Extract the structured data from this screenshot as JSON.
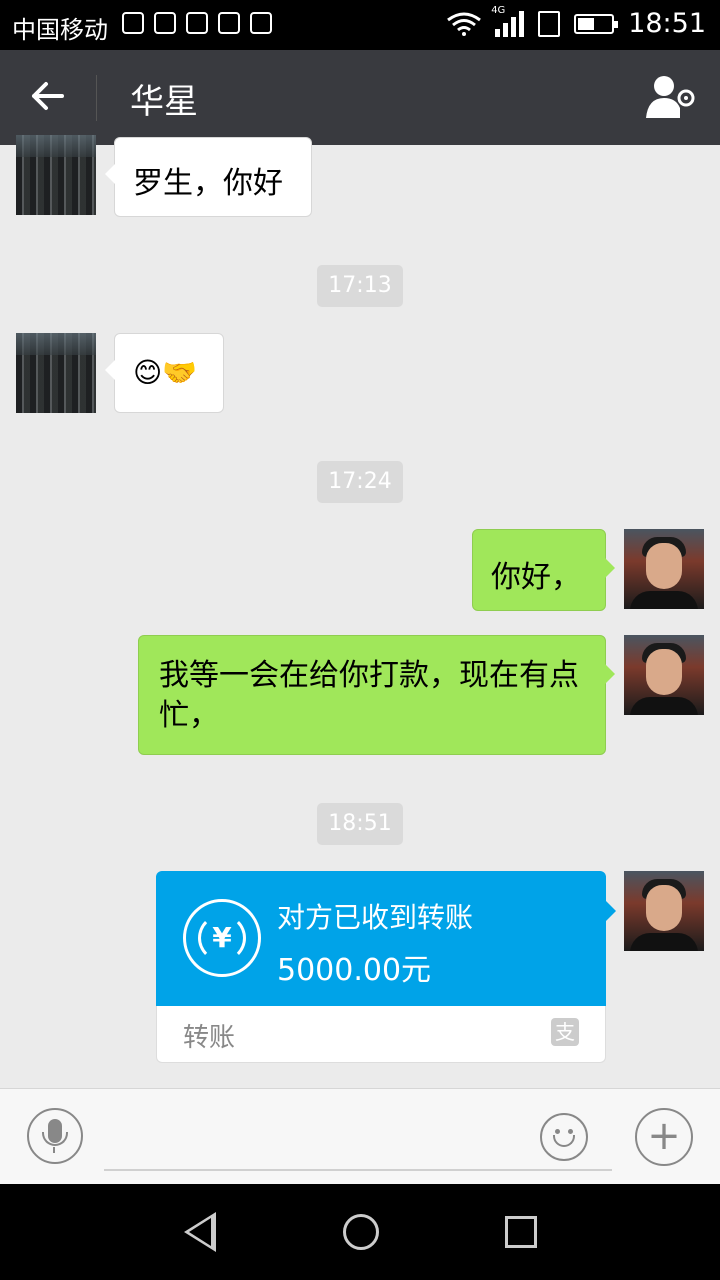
{
  "status_bar": {
    "carrier": "中国移动",
    "network_tag": "4G",
    "time": "18:51",
    "battery_level": 0.4
  },
  "header": {
    "back_icon": "arrow-left-icon",
    "title": "华星",
    "settings_icon": "user-settings-icon"
  },
  "messages": [
    {
      "from": "contact",
      "text": "罗生，你好"
    },
    {
      "type": "timestamp",
      "text": "17:13"
    },
    {
      "from": "contact",
      "text": "😊🤝"
    },
    {
      "type": "timestamp",
      "text": "17:24"
    },
    {
      "from": "me",
      "text": "你好，"
    },
    {
      "from": "me",
      "text": "我等一会在给你打款，现在有点忙，"
    },
    {
      "type": "timestamp",
      "text": "18:51"
    }
  ],
  "transfer": {
    "status": "对方已收到转账",
    "amount": "5000.00元",
    "label": "转账",
    "logo_glyph": "支",
    "icon_glyph": "¥"
  },
  "input_bar": {
    "voice_icon": "microphone-icon",
    "emoji_icon": "smiley-icon",
    "plus_glyph": "+",
    "placeholder": ""
  },
  "colors": {
    "title_bar": "#393a3f",
    "chat_bg": "#ebebeb",
    "my_bubble": "#a0e75a",
    "transfer_blue": "#00a3e8"
  }
}
